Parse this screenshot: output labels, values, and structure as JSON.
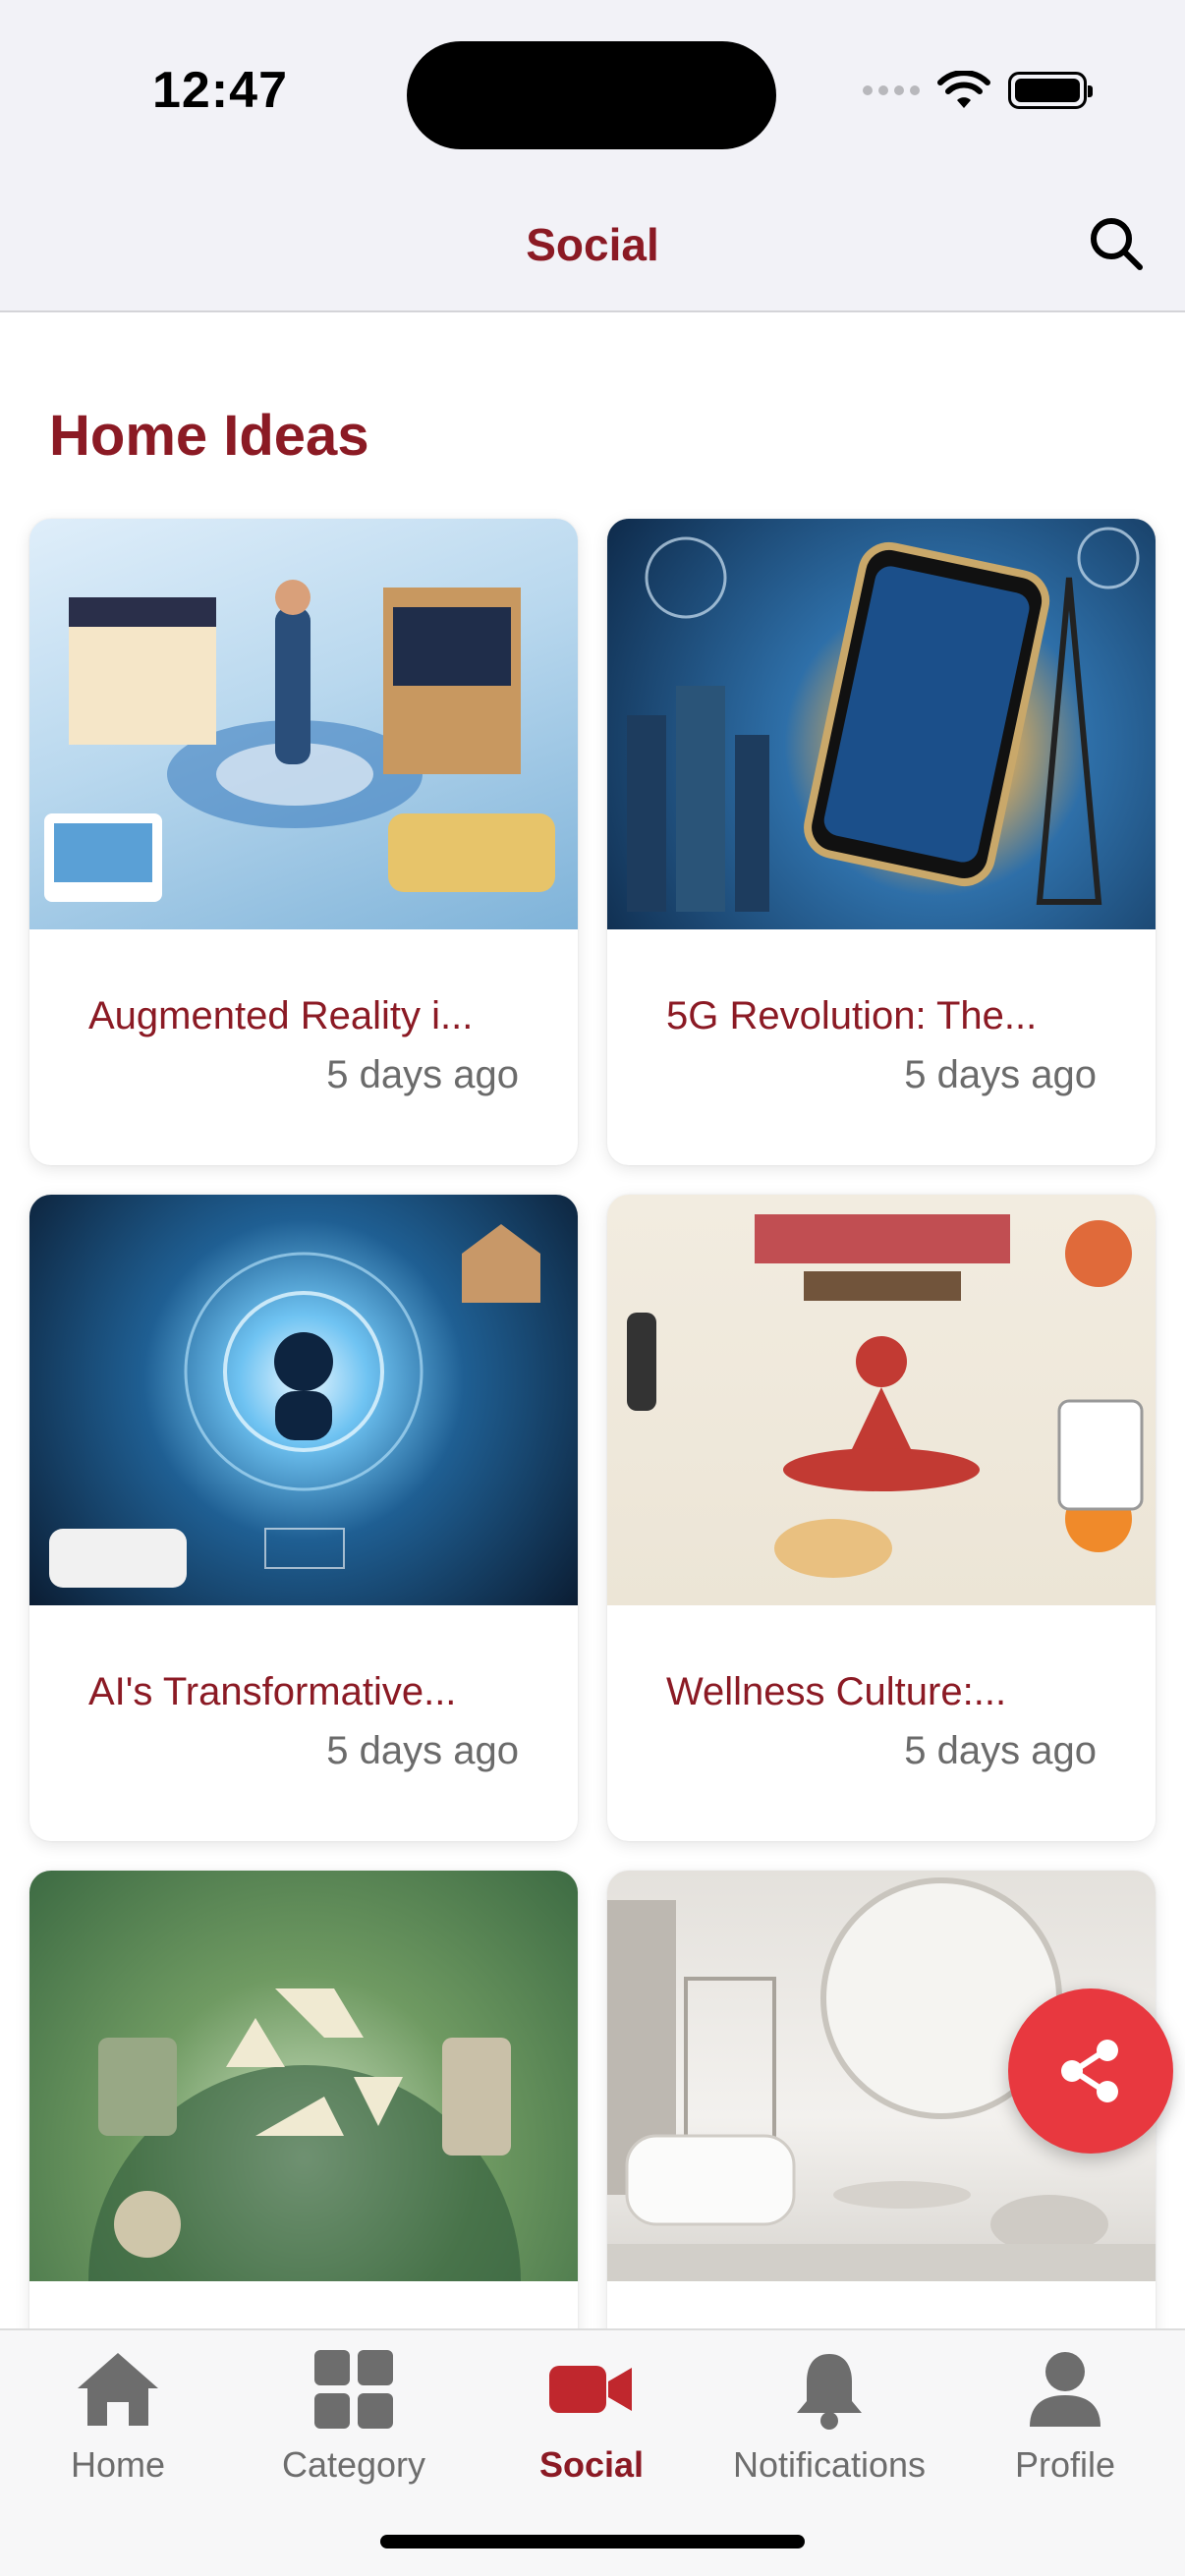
{
  "status_bar": {
    "time": "12:47"
  },
  "header": {
    "title": "Social",
    "search_icon": "search-icon"
  },
  "section": {
    "title": "Home Ideas"
  },
  "cards": [
    {
      "title": "Augmented Reality i...",
      "meta": "5 days ago"
    },
    {
      "title": "5G Revolution: The...",
      "meta": "5 days ago"
    },
    {
      "title": "AI's Transformative...",
      "meta": "5 days ago"
    },
    {
      "title": "Wellness Culture:...",
      "meta": "5 days ago"
    },
    {
      "title": "",
      "meta": ""
    },
    {
      "title": "",
      "meta": ""
    }
  ],
  "fab": {
    "icon": "share-icon",
    "color": "#e8383f"
  },
  "tabbar": {
    "items": [
      {
        "label": "Home",
        "icon": "home-icon"
      },
      {
        "label": "Category",
        "icon": "grid-icon"
      },
      {
        "label": "Social",
        "icon": "video-camera-icon"
      },
      {
        "label": "Notifications",
        "icon": "bell-icon"
      },
      {
        "label": "Profile",
        "icon": "person-icon"
      }
    ],
    "active": "Social"
  },
  "colors": {
    "accent": "#8b1a24",
    "fab": "#e8383f",
    "inactive": "#6d6d6d"
  }
}
